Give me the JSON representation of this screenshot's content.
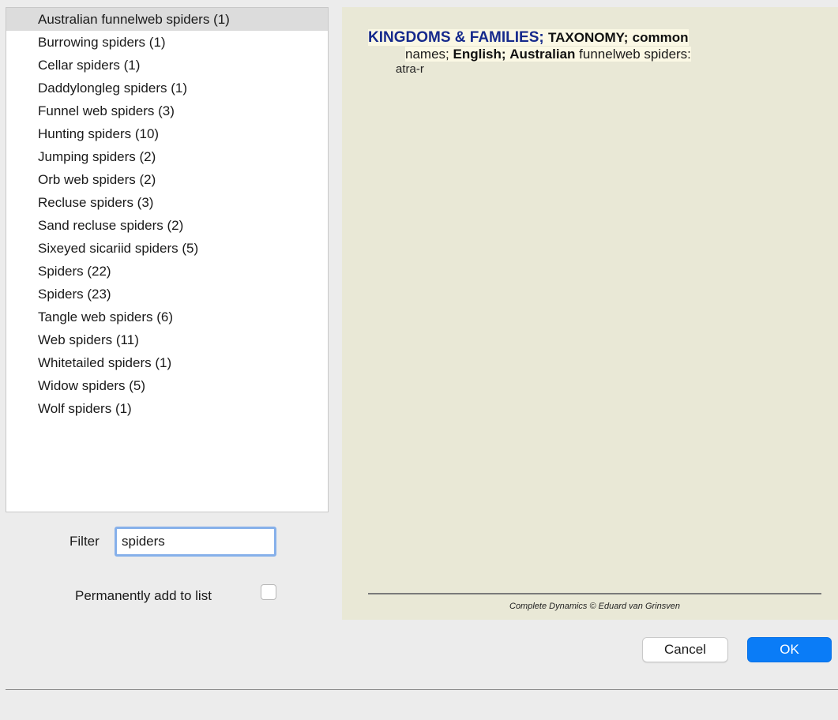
{
  "list": {
    "items": [
      {
        "label": "Australian funnelweb spiders (1)",
        "selected": true
      },
      {
        "label": "Burrowing spiders (1)"
      },
      {
        "label": "Cellar spiders (1)"
      },
      {
        "label": "Daddylongleg spiders (1)"
      },
      {
        "label": "Funnel web spiders (3)"
      },
      {
        "label": "Hunting spiders (10)"
      },
      {
        "label": "Jumping spiders (2)"
      },
      {
        "label": "Orb web spiders (2)"
      },
      {
        "label": "Recluse spiders (3)"
      },
      {
        "label": "Sand recluse spiders (2)"
      },
      {
        "label": "Sixeyed sicariid spiders (5)"
      },
      {
        "label": "Spiders (22)"
      },
      {
        "label": "Spiders (23)"
      },
      {
        "label": "Tangle web spiders (6)"
      },
      {
        "label": "Web spiders (11)"
      },
      {
        "label": "Whitetailed spiders (1)"
      },
      {
        "label": "Widow spiders (5)"
      },
      {
        "label": "Wolf spiders (1)"
      }
    ]
  },
  "filter": {
    "label": "Filter",
    "value": "spiders"
  },
  "permanent": {
    "label": "Permanently add to list",
    "checked": false
  },
  "preview": {
    "kingdoms": "KINGDOMS & FAMILIES;",
    "taxonomy": "TAXONOMY;",
    "common": "common",
    "names": "names;",
    "english": "English;",
    "australian": "Australian",
    "species": "funnelweb spiders:",
    "remedy": "atra-r",
    "copyright": "Complete Dynamics © Eduard van Grinsven"
  },
  "buttons": {
    "cancel": "Cancel",
    "ok": "OK"
  },
  "colors": {
    "accent": "#0a7cf7",
    "preview_background": "#e9e8d6",
    "heading_blue": "#162a8c",
    "selection": "#dcdcdc"
  }
}
